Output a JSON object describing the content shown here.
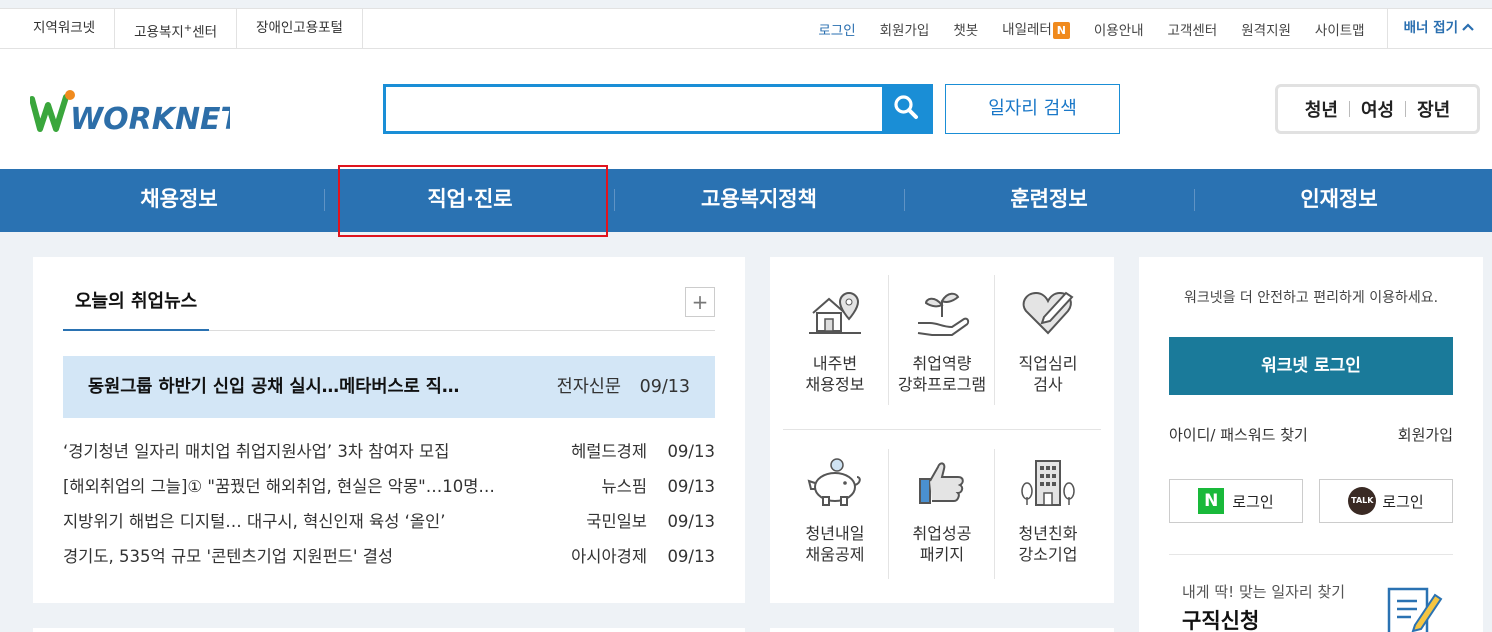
{
  "topbar": {
    "sites": [
      "지역워크넷",
      "고용복지",
      "센터",
      "장애인고용포털"
    ],
    "sites_sup": "+",
    "links": {
      "login": "로그인",
      "signup": "회원가입",
      "chatbot": "챗봇",
      "myletter": "내일레터",
      "myletter_badge": "N",
      "guide": "이용안내",
      "customer": "고객센터",
      "remote": "원격지원",
      "sitemap": "사이트맵"
    },
    "fold_banner": "배너 접기"
  },
  "header": {
    "logo_text": "WORKNET",
    "search_placeholder": "",
    "job_search_label": "일자리 검색",
    "targets": [
      "청년",
      "여성",
      "장년"
    ]
  },
  "gnb": {
    "items": [
      "채용정보",
      "직업·진로",
      "고용복지정책",
      "훈련정보",
      "인재정보"
    ]
  },
  "news": {
    "tab": "오늘의 취업뉴스",
    "plus": "+",
    "top": {
      "title": "동원그룹 하반기 신입 공채 실시…메타버스로 직…",
      "source": "전자신문",
      "date": "09/13"
    },
    "rows": [
      {
        "title": "‘경기청년 일자리 매치업 취업지원사업’ 3차 참여자 모집",
        "source": "헤럴드경제",
        "date": "09/13"
      },
      {
        "title": "[해외취업의 그늘]① \"꿈꿨던 해외취업, 현실은 악몽\"…10명…",
        "source": "뉴스핌",
        "date": "09/13"
      },
      {
        "title": "지방위기 해법은 디지털… 대구시, 혁신인재 육성 ‘올인’",
        "source": "국민일보",
        "date": "09/13"
      },
      {
        "title": "경기도, 535억 규모 '콘텐츠기업 지원펀드' 결성",
        "source": "아시아경제",
        "date": "09/13"
      }
    ]
  },
  "quick": {
    "items": [
      {
        "line1": "내주변",
        "line2": "채용정보",
        "icon": "house-location-icon"
      },
      {
        "line1": "취업역량",
        "line2": "강화프로그램",
        "icon": "sprout-hand-icon"
      },
      {
        "line1": "직업심리",
        "line2": "검사",
        "icon": "heart-pen-icon"
      },
      {
        "line1": "청년내일",
        "line2": "채움공제",
        "icon": "piggy-bank-icon"
      },
      {
        "line1": "취업성공",
        "line2": "패키지",
        "icon": "thumbs-up-icon"
      },
      {
        "line1": "청년친화",
        "line2": "강소기업",
        "icon": "building-icon"
      }
    ]
  },
  "login": {
    "message": "워크넷을 더 안전하고 편리하게 이용하세요.",
    "button": "워크넷 로그인",
    "find": "아이디/ 패스워드 찾기",
    "join": "회원가입",
    "naver_icon": "N",
    "kakao_icon": "TALK",
    "sns_label": "로그인",
    "apply_sub": "내게 딱! 맞는 일자리 찾기",
    "apply_title": "구직신청"
  },
  "colors": {
    "gnb_bg": "#2a72b2",
    "accent_blue": "#1a8ed6",
    "login_btn": "#1a7a9a",
    "highlight_red": "#e0141e",
    "news_top_bg": "#d3e6f6"
  }
}
